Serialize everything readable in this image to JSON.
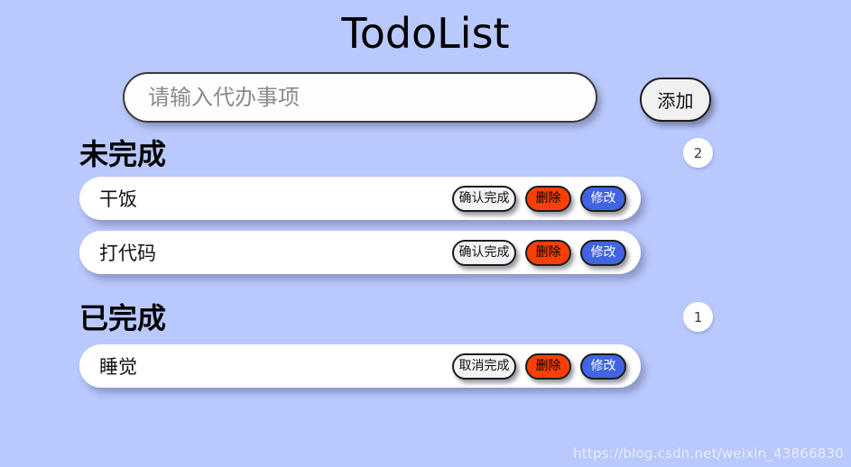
{
  "app": {
    "title": "TodoList",
    "background_color": "#b9c8fd"
  },
  "input_area": {
    "placeholder": "请输入代办事项",
    "value": "",
    "add_button_label": "添加"
  },
  "sections": [
    {
      "title": "未完成",
      "count": "2",
      "tasks": [
        {
          "text": "干饭",
          "toggle_label": "确认完成",
          "delete_label": "删除",
          "edit_label": "修改"
        },
        {
          "text": "打代码",
          "toggle_label": "确认完成",
          "delete_label": "删除",
          "edit_label": "修改"
        }
      ]
    },
    {
      "title": "已完成",
      "count": "1",
      "tasks": [
        {
          "text": "睡觉",
          "toggle_label": "取消完成",
          "delete_label": "删除",
          "edit_label": "修改"
        }
      ]
    }
  ],
  "colors": {
    "delete_button": "#f93f06",
    "edit_button": "#4164e3",
    "toggle_button": "#f3f3f3",
    "row_background": "#ffffff"
  },
  "watermark": "https://blog.csdn.net/weixin_43866830"
}
